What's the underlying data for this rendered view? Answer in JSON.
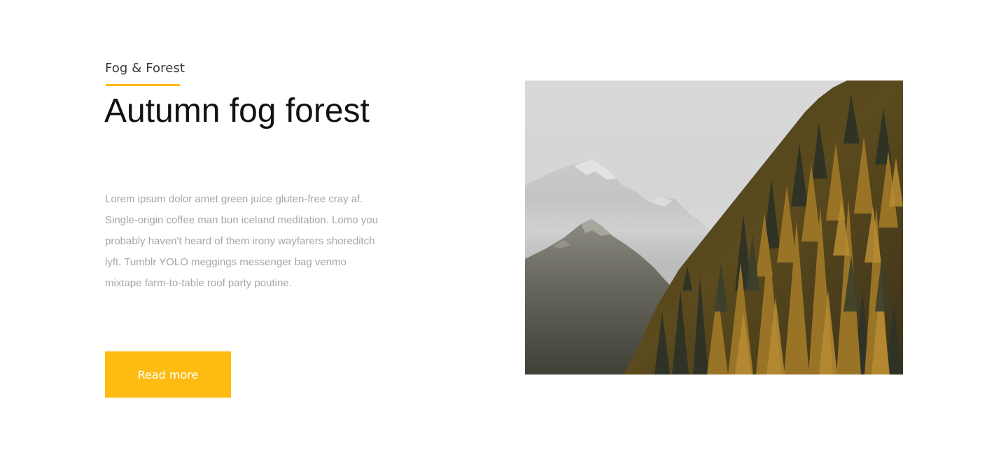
{
  "section": {
    "eyebrow": "Fog & Forest",
    "title": "Autumn fog forest",
    "body": "Lorem ipsum dolor amet green juice gluten-free cray af. Single-origin coffee man bun iceland meditation. Lomo you probably haven't heard of them irony wayfarers shoreditch lyft. Tumblr YOLO meggings messenger bag venmo mixtape farm-to-table roof party poutine.",
    "button_label": "Read more"
  },
  "colors": {
    "accent": "#febb12",
    "title": "#111111",
    "body_text": "#a6a6a6",
    "eyebrow": "#3a3a3a"
  },
  "image": {
    "subject": "misty-mountains-with-autumn-larch-forest"
  }
}
